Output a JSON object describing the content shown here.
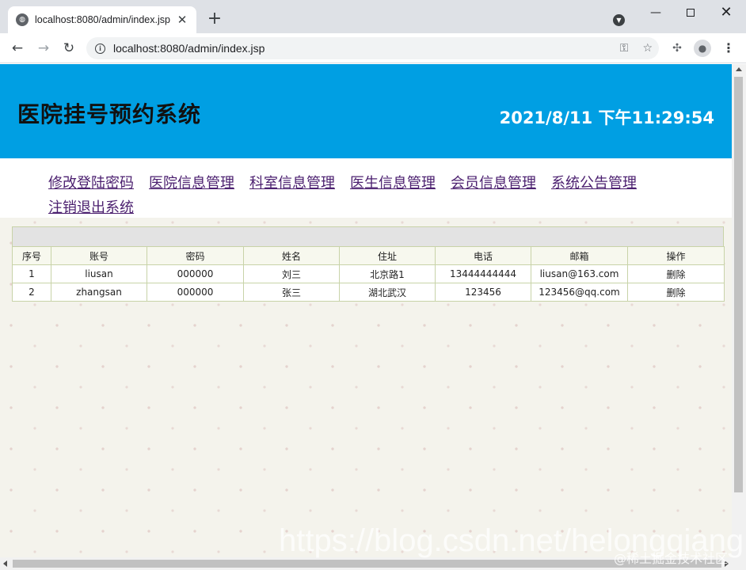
{
  "browser": {
    "tab_title": "localhost:8080/admin/index.jsp",
    "tab_close": "✕",
    "new_tab": "+",
    "url": "localhost:8080/admin/index.jsp",
    "icons": [
      "globe-icon",
      "tab-search-icon",
      "back-icon",
      "forward-icon",
      "reload-icon",
      "info-icon",
      "key-icon",
      "star-icon",
      "extensions-icon",
      "profile-icon",
      "menu-icon"
    ]
  },
  "header": {
    "title": "医院挂号预约系统",
    "clock": "2021/8/11 下午11:29:54",
    "background": "#009fe3"
  },
  "nav": {
    "items": [
      "修改登陆密码",
      "医院信息管理",
      "科室信息管理",
      "医生信息管理",
      "会员信息管理",
      "系统公告管理",
      "注销退出系统"
    ],
    "link_color": "#4b1f6f"
  },
  "table": {
    "columns": [
      "序号",
      "账号",
      "密码",
      "姓名",
      "住址",
      "电话",
      "邮箱",
      "操作"
    ],
    "rows": [
      [
        "1",
        "liusan",
        "000000",
        "刘三",
        "北京路1",
        "13444444444",
        "liusan@163.com",
        "删除"
      ],
      [
        "2",
        "zhangsan",
        "000000",
        "张三",
        "湖北武汉",
        "123456",
        "123456@qq.com",
        "删除"
      ]
    ]
  },
  "watermark": {
    "url": "https://blog.csdn.net/helongqiang",
    "community": "@稀土掘金技术社区"
  }
}
